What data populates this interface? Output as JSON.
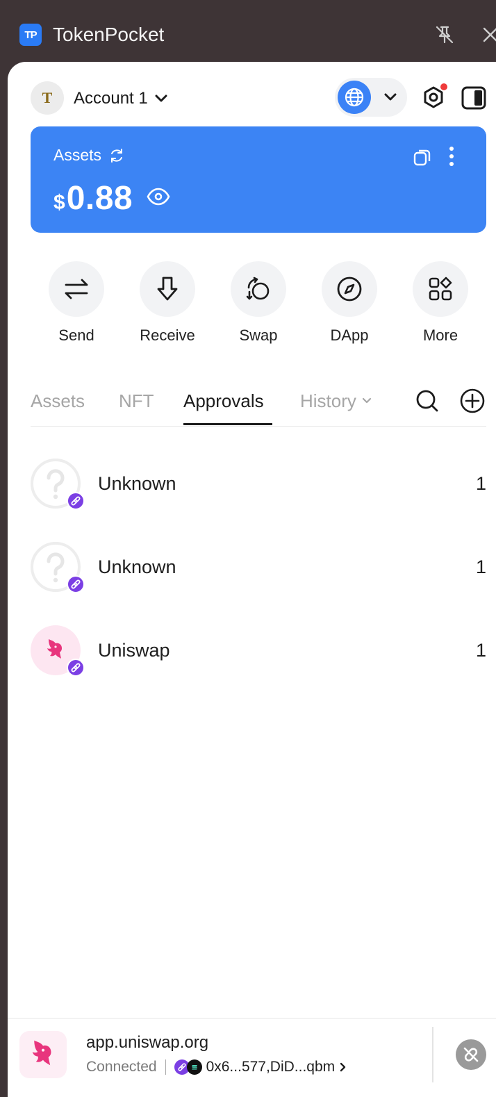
{
  "window": {
    "title": "TokenPocket",
    "logo_text": "TP"
  },
  "header": {
    "avatar_letter": "T",
    "account_name": "Account 1"
  },
  "assets_card": {
    "label": "Assets",
    "currency_symbol": "$",
    "balance": "0.88"
  },
  "actions": [
    {
      "label": "Send",
      "icon": "transfer-arrows-icon"
    },
    {
      "label": "Receive",
      "icon": "arrow-down-icon"
    },
    {
      "label": "Swap",
      "icon": "swap-icon"
    },
    {
      "label": "DApp",
      "icon": "compass-icon"
    },
    {
      "label": "More",
      "icon": "grid-icon"
    }
  ],
  "tabs": [
    {
      "label": "Assets",
      "active": false
    },
    {
      "label": "NFT",
      "active": false
    },
    {
      "label": "Approvals",
      "active": true
    },
    {
      "label": "History",
      "active": false
    }
  ],
  "approvals": [
    {
      "name": "Unknown",
      "count": "1",
      "icon": "question-mark-icon"
    },
    {
      "name": "Unknown",
      "count": "1",
      "icon": "question-mark-icon"
    },
    {
      "name": "Uniswap",
      "count": "1",
      "icon": "uniswap-unicorn-icon"
    }
  ],
  "connection": {
    "url": "app.uniswap.org",
    "status": "Connected",
    "addresses": "0x6...577,DiD...qbm"
  },
  "colors": {
    "accent": "#3c84f4",
    "chain_badge": "#7b3fe4",
    "notification": "#ef3b3b",
    "window_bg": "#3e3436"
  }
}
